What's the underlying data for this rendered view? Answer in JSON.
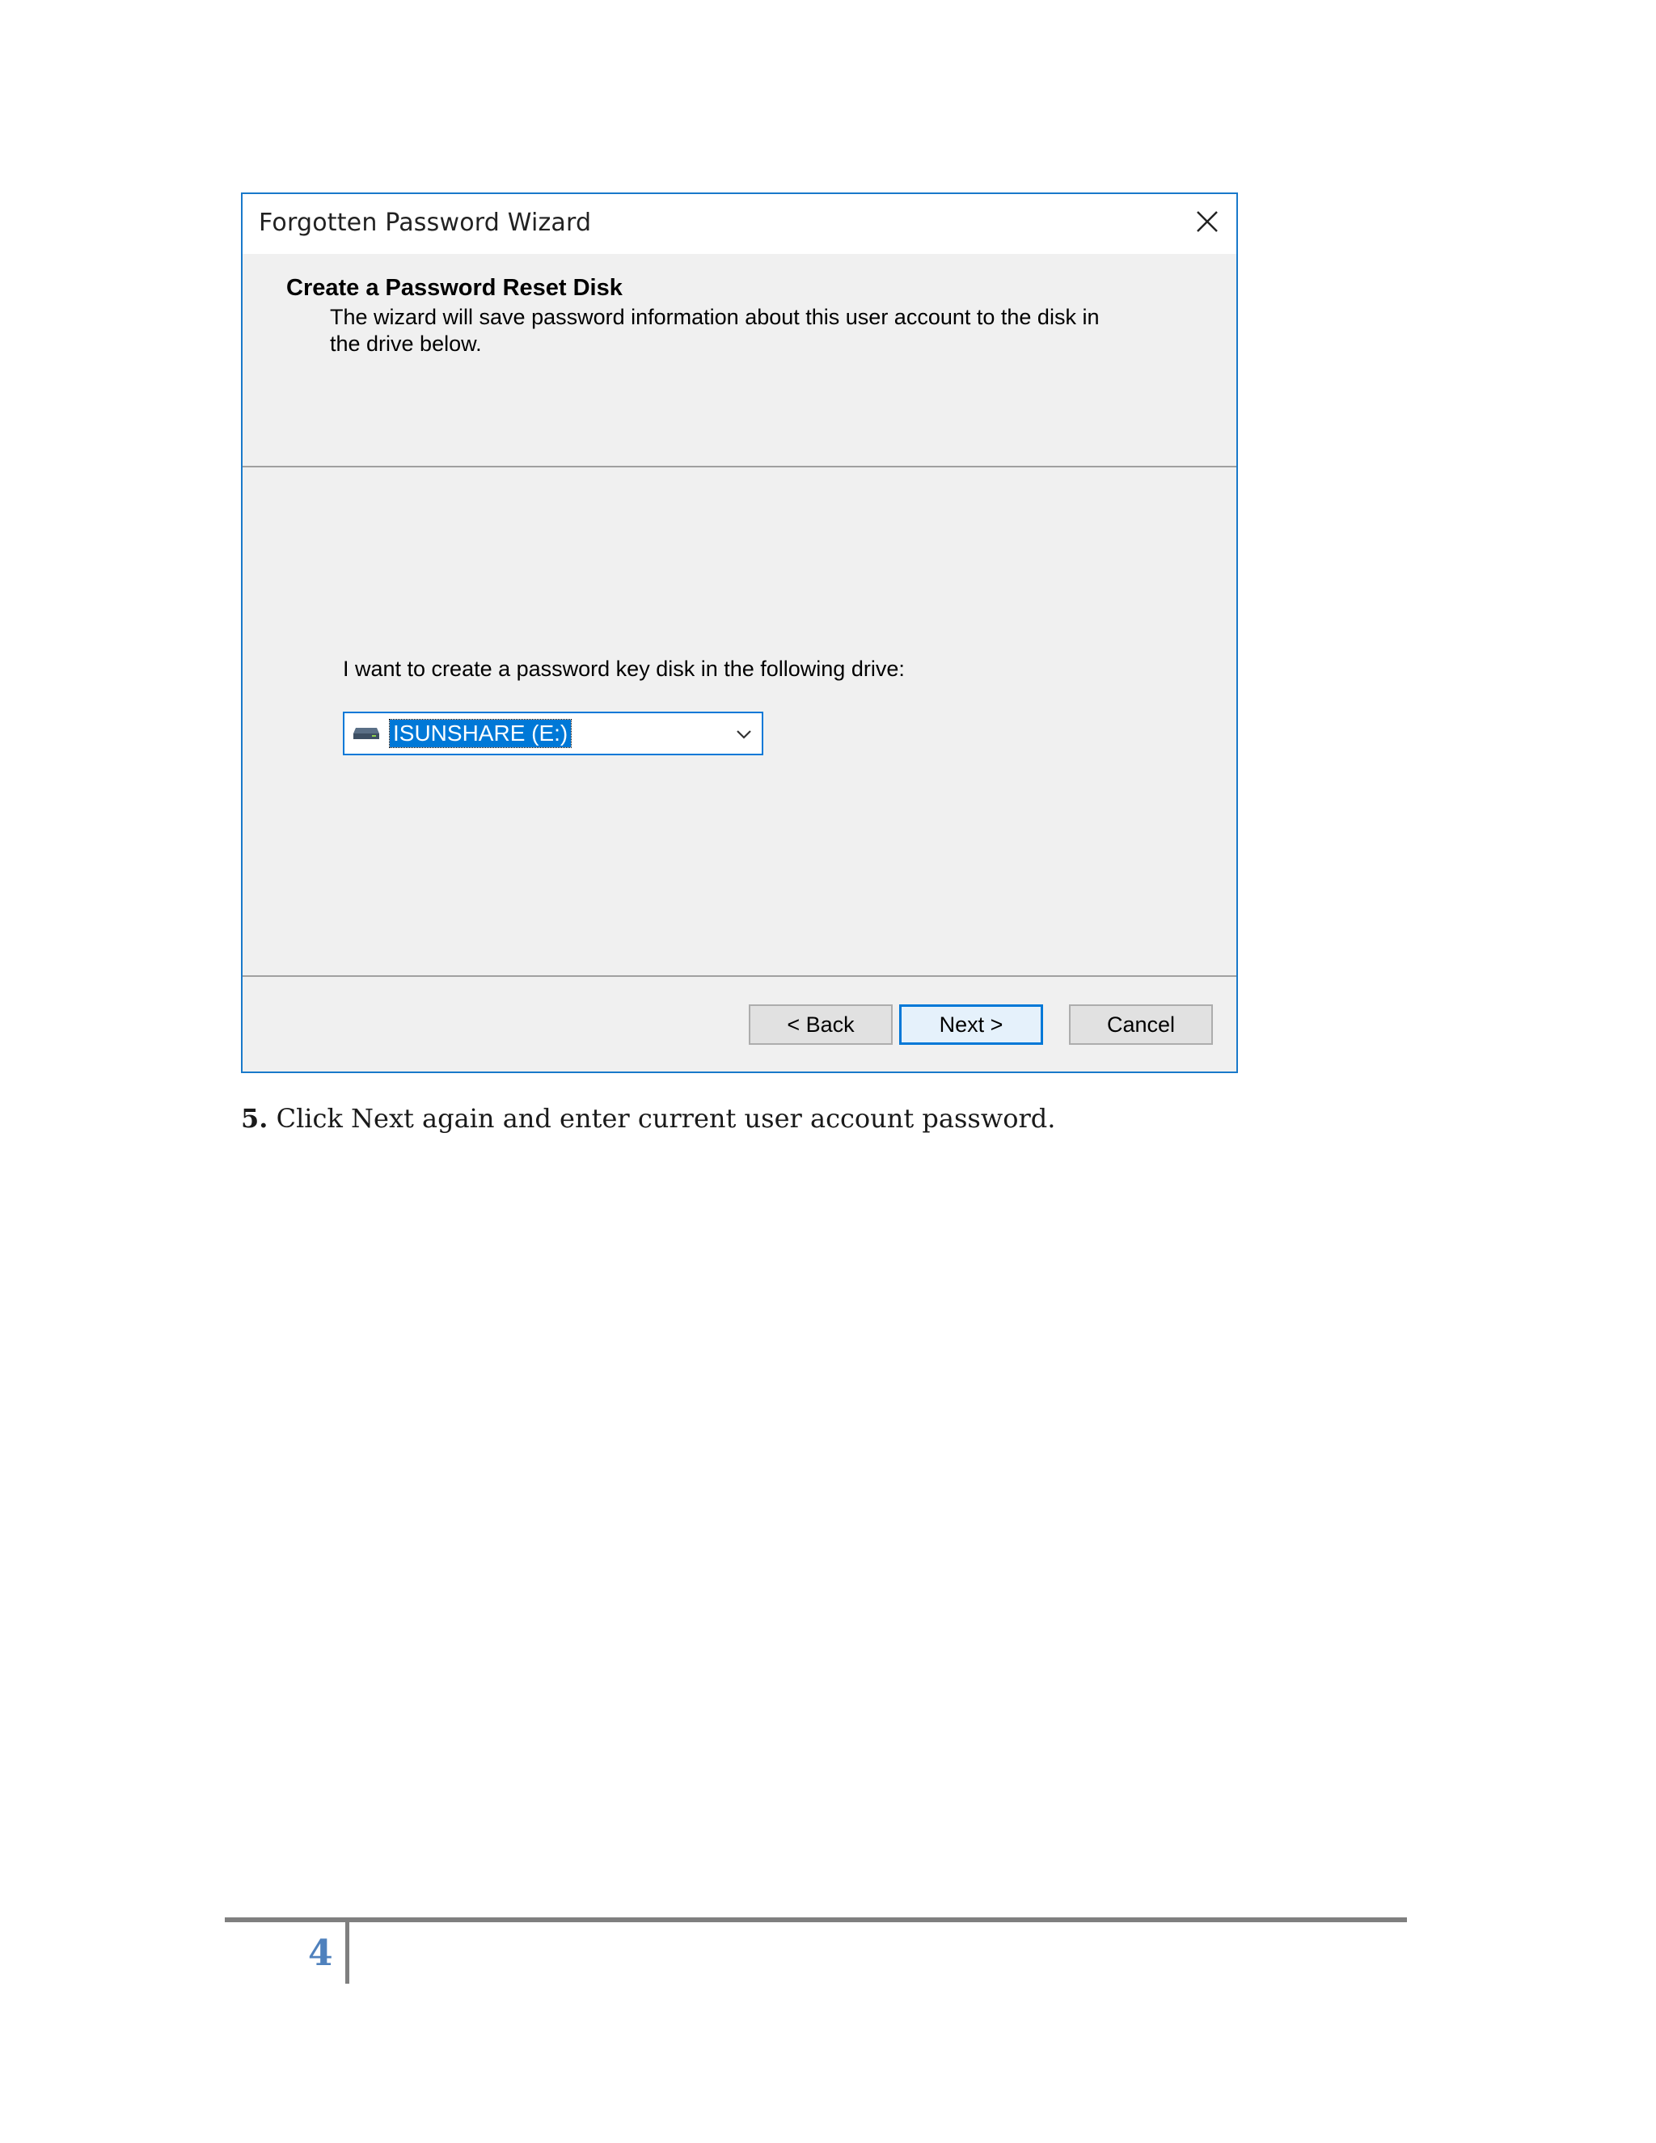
{
  "dialog": {
    "window_title": "Forgotten Password Wizard",
    "close_icon": "close-icon",
    "header": {
      "title": "Create a Password Reset Disk",
      "description": "The wizard will save password information about this user account to the disk in the drive below."
    },
    "content": {
      "prompt": "I want to create a password key disk in the following drive:",
      "drive_select": {
        "selected_value": "ISUNSHARE (E:)",
        "icon": "usb-drive-icon"
      }
    },
    "buttons": {
      "back_label": "< Back",
      "next_label": "Next >",
      "cancel_label": "Cancel"
    }
  },
  "document": {
    "step_number": "5.",
    "step_text": " Click Next again and enter current user account password.",
    "page_number": "4"
  },
  "colors": {
    "window_border": "#1979ca",
    "selection": "#0078d7",
    "page_number": "#4f81bd"
  }
}
